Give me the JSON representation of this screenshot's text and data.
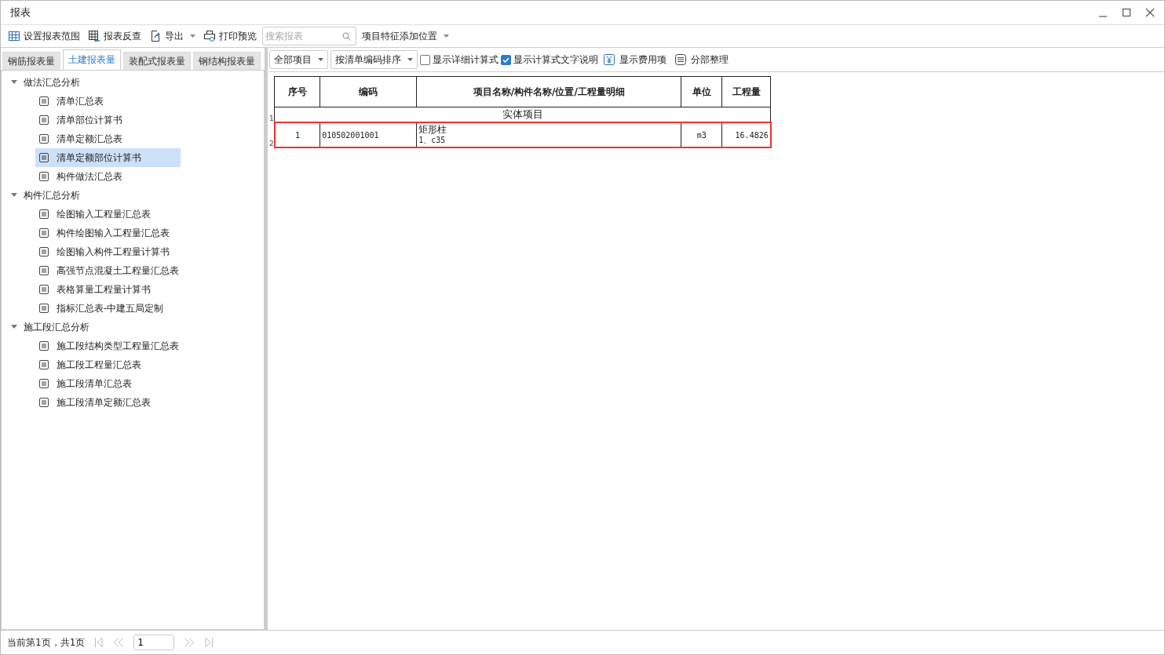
{
  "window": {
    "title": "报表"
  },
  "toolbar": {
    "items": [
      {
        "kind": "button",
        "label": "设置报表范围"
      },
      {
        "kind": "button",
        "label": "报表反查"
      },
      {
        "kind": "dropdown",
        "label": "导出"
      },
      {
        "kind": "button",
        "label": "打印预览"
      }
    ],
    "search": {
      "placeholder": "搜索报表"
    },
    "feature_position": {
      "label": "项目特征添加位置"
    }
  },
  "tabs": [
    {
      "label": "钢筋报表量",
      "selected": false
    },
    {
      "label": "土建报表量",
      "selected": true
    },
    {
      "label": "装配式报表量",
      "selected": false
    },
    {
      "label": "钢结构报表量",
      "selected": false
    }
  ],
  "tree": [
    {
      "label": "做法汇总分析",
      "expanded": true,
      "children": [
        {
          "label": "清单汇总表",
          "selected": false
        },
        {
          "label": "清单部位计算书",
          "selected": false
        },
        {
          "label": "清单定额汇总表",
          "selected": false
        },
        {
          "label": "清单定额部位计算书",
          "selected": true
        },
        {
          "label": "构件做法汇总表",
          "selected": false
        }
      ]
    },
    {
      "label": "构件汇总分析",
      "expanded": true,
      "children": [
        {
          "label": "绘图输入工程量汇总表",
          "selected": false
        },
        {
          "label": "构件绘图输入工程量汇总表",
          "selected": false
        },
        {
          "label": "绘图输入构件工程量计算书",
          "selected": false
        },
        {
          "label": "高强节点混凝土工程量汇总表",
          "selected": false
        },
        {
          "label": "表格算量工程量计算书",
          "selected": false
        },
        {
          "label": "指标汇总表-中建五局定制",
          "selected": false
        }
      ]
    },
    {
      "label": "施工段汇总分析",
      "expanded": true,
      "children": [
        {
          "label": "施工段结构类型工程量汇总表",
          "selected": false
        },
        {
          "label": "施工段工程量汇总表",
          "selected": false
        },
        {
          "label": "施工段清单汇总表",
          "selected": false
        },
        {
          "label": "施工段清单定额汇总表",
          "selected": false
        }
      ]
    }
  ],
  "report_bar": [
    {
      "kind": "dropdown",
      "label": "全部项目"
    },
    {
      "kind": "dropdown",
      "label": "按清单编码排序"
    },
    {
      "kind": "checkbox",
      "label": "显示详细计算式",
      "checked": false
    },
    {
      "kind": "checkbox",
      "label": "显示计算式文字说明",
      "checked": true
    },
    {
      "kind": "button",
      "label": "显示费用项"
    },
    {
      "kind": "button",
      "label": "分部整理"
    }
  ],
  "table": {
    "columns": [
      "序号",
      "编码",
      "项目名称/构件名称/位置/工程量明细",
      "单位",
      "工程量"
    ],
    "rows": [
      {
        "kind": "group",
        "row_number": "1",
        "title": "实体项目",
        "selected": false
      },
      {
        "kind": "item",
        "row_number": "2",
        "selected": true,
        "index": "1",
        "code": "010502001001",
        "name": "矩形柱",
        "detail": "1、c35",
        "unit": "m3",
        "quantity": "16.4826"
      }
    ]
  },
  "status_bar": {
    "page_info": "当前第1页，共1页",
    "page_input": "1"
  }
}
